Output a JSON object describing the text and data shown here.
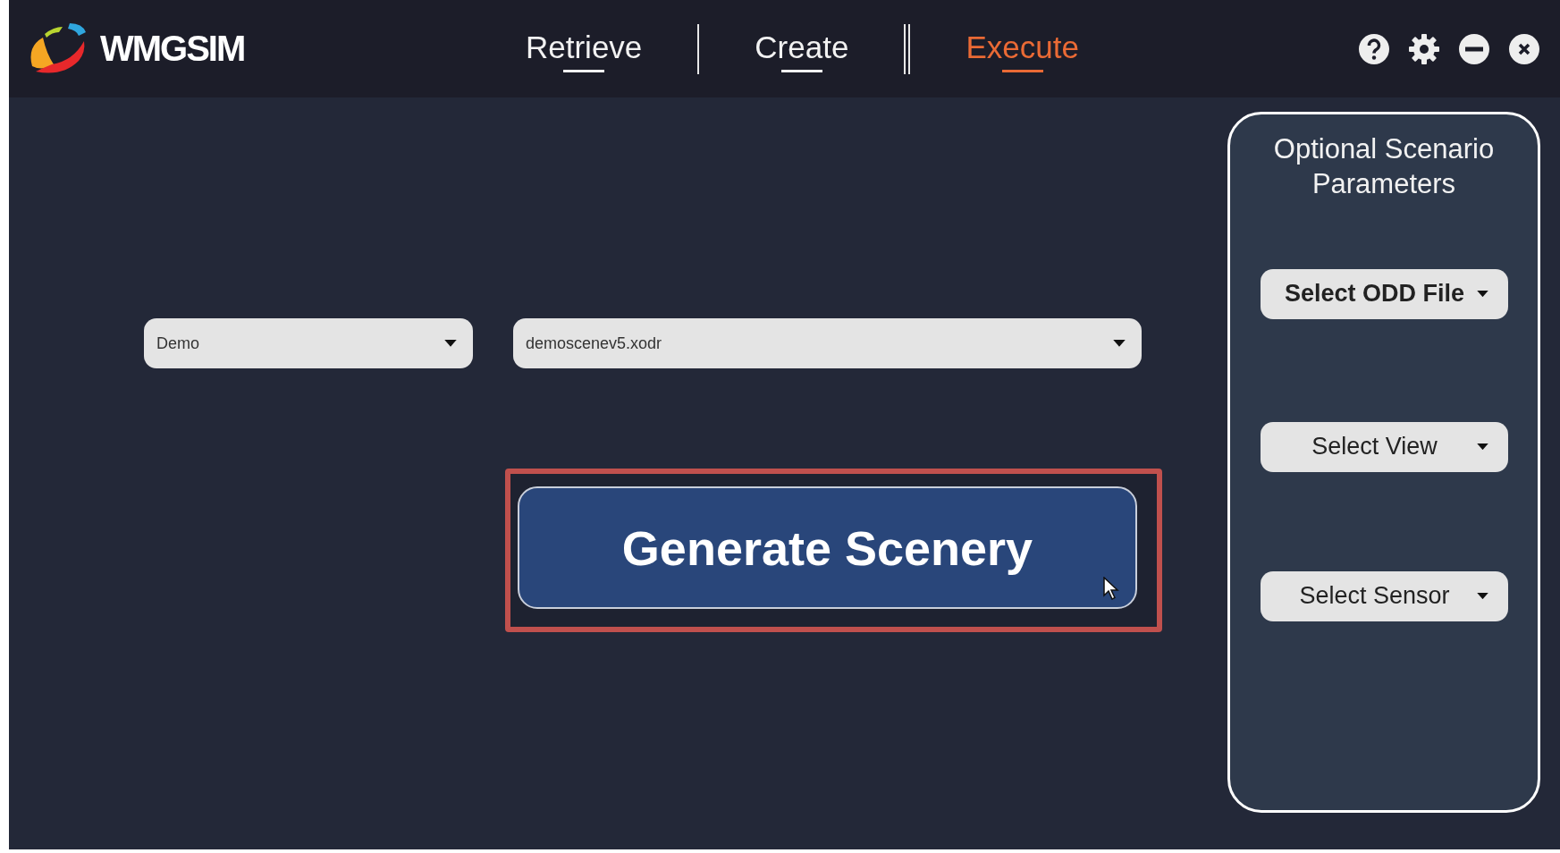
{
  "app": {
    "name": "WMGSIM"
  },
  "tabs": [
    {
      "label": "Retrieve",
      "selected": false
    },
    {
      "label": "Create",
      "selected": false
    },
    {
      "label": "Execute",
      "selected": true
    }
  ],
  "window_controls": [
    {
      "kind": "help"
    },
    {
      "kind": "settings"
    },
    {
      "kind": "minimize"
    },
    {
      "kind": "close"
    }
  ],
  "selectors": [
    {
      "value": "Demo",
      "kind": "narrow"
    },
    {
      "value": "demoscenev5.xodr",
      "kind": "wide"
    }
  ],
  "generate_button": {
    "label": "Generate Scenery",
    "highlighted": true
  },
  "optional_panel": {
    "title": "Optional Scenario Parameters",
    "dropdowns": [
      {
        "label": "Select ODD File",
        "bold": true
      },
      {
        "label": "Select View",
        "bold": false
      },
      {
        "label": "Select Sensor",
        "bold": false
      }
    ]
  }
}
